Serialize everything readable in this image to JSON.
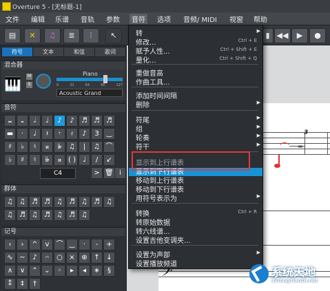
{
  "window": {
    "title": "Overture 5 - [无标题-1]"
  },
  "menubar": [
    "文件",
    "编辑",
    "乐谱",
    "音轨",
    "参数",
    "音符",
    "选项",
    "音频/ MIDI",
    "视窗",
    "帮助"
  ],
  "palette_tabs": [
    "符号",
    "文本",
    "和弦",
    "歌词"
  ],
  "mixer": {
    "header": "混合器",
    "instrument": "Piano",
    "patch": "Acoustic Grand",
    "scale": [
      "0",
      "32",
      "64",
      "96",
      "127"
    ]
  },
  "notes_section": {
    "header": "音符",
    "pitch": "C4"
  },
  "sections": {
    "beam": "群体",
    "marks": "记号"
  },
  "context_menu": {
    "items": [
      {
        "label": "转",
        "shortcut": "",
        "submenu": true
      },
      {
        "label": "修改...",
        "shortcut": "Ctrl + E",
        "submenu": false
      },
      {
        "label": "赋予人性...",
        "shortcut": "Ctrl + Shift + E",
        "submenu": false
      },
      {
        "label": "量化...",
        "shortcut": "Ctrl + Shift + Q",
        "submenu": false
      },
      {
        "label": "重做音高",
        "shortcut": "",
        "submenu": false
      },
      {
        "label": "作曲工具...",
        "shortcut": "",
        "submenu": false
      },
      {
        "label": "添加时间间隔",
        "shortcut": "",
        "submenu": false
      },
      {
        "label": "删除",
        "shortcut": "",
        "submenu": true
      },
      {
        "label": "符尾",
        "shortcut": "",
        "submenu": true
      },
      {
        "label": "组",
        "shortcut": "",
        "submenu": true
      },
      {
        "label": "轮奏",
        "shortcut": "",
        "submenu": true
      },
      {
        "label": "符干",
        "shortcut": "",
        "submenu": true
      },
      {
        "label": "显示到上行谱表",
        "shortcut": "",
        "submenu": false
      },
      {
        "label": "显示到下行谱表",
        "shortcut": "",
        "submenu": false
      },
      {
        "label": "移动到上行谱表",
        "shortcut": "",
        "submenu": false
      },
      {
        "label": "移动到下行谱表",
        "shortcut": "",
        "submenu": false
      },
      {
        "label": "用符号表示为",
        "shortcut": "",
        "submenu": true
      },
      {
        "label": "转换",
        "shortcut": "Ctrl + R",
        "submenu": false
      },
      {
        "label": "转原始数据",
        "shortcut": "",
        "submenu": false
      },
      {
        "label": "转六线谱...",
        "shortcut": "",
        "submenu": false
      },
      {
        "label": "设置吉他变调夹...",
        "shortcut": "",
        "submenu": false
      },
      {
        "label": "设置为声部",
        "shortcut": "",
        "submenu": true
      },
      {
        "label": "设置播放频道",
        "shortcut": "",
        "submenu": false
      }
    ]
  },
  "score": {
    "measure_number": "3"
  },
  "watermark": {
    "cn": "系统天地",
    "en": "XiTongTianDi.net"
  },
  "colors": {
    "accent": "#1593d4",
    "highlight_box": "#e23a3a"
  }
}
